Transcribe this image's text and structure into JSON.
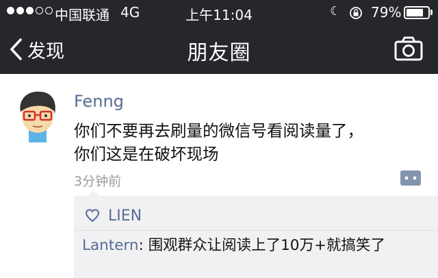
{
  "status_bar": {
    "signal_dots": [
      "full",
      "full",
      "full",
      "empty",
      "empty"
    ],
    "carrier": "中国联通",
    "network": "4G",
    "time": "上午11:04",
    "battery_percent": "79%",
    "battery_level": 0.79,
    "icons": [
      "moon-icon",
      "rotation-lock-icon",
      "battery-icon"
    ]
  },
  "nav": {
    "back_label": "发现",
    "title": "朋友圈",
    "back_icon": "chevron-left-icon",
    "camera_icon": "camera-icon"
  },
  "post": {
    "author": "Fenng",
    "text_lines": [
      "你们不要再去刷量的微信号看阅读量了，",
      "你们这是在破坏现场"
    ],
    "time_ago": "3分钟前",
    "likes": [
      "LIEN"
    ],
    "comments": [
      {
        "author": "Lantern",
        "separator": ": ",
        "text": "围观群众让阅读上了10万+就搞笑了"
      }
    ]
  },
  "colors": {
    "nav_bg": "#25272b",
    "name_link": "#576b95",
    "likes_bg": "#f1f1f3"
  }
}
